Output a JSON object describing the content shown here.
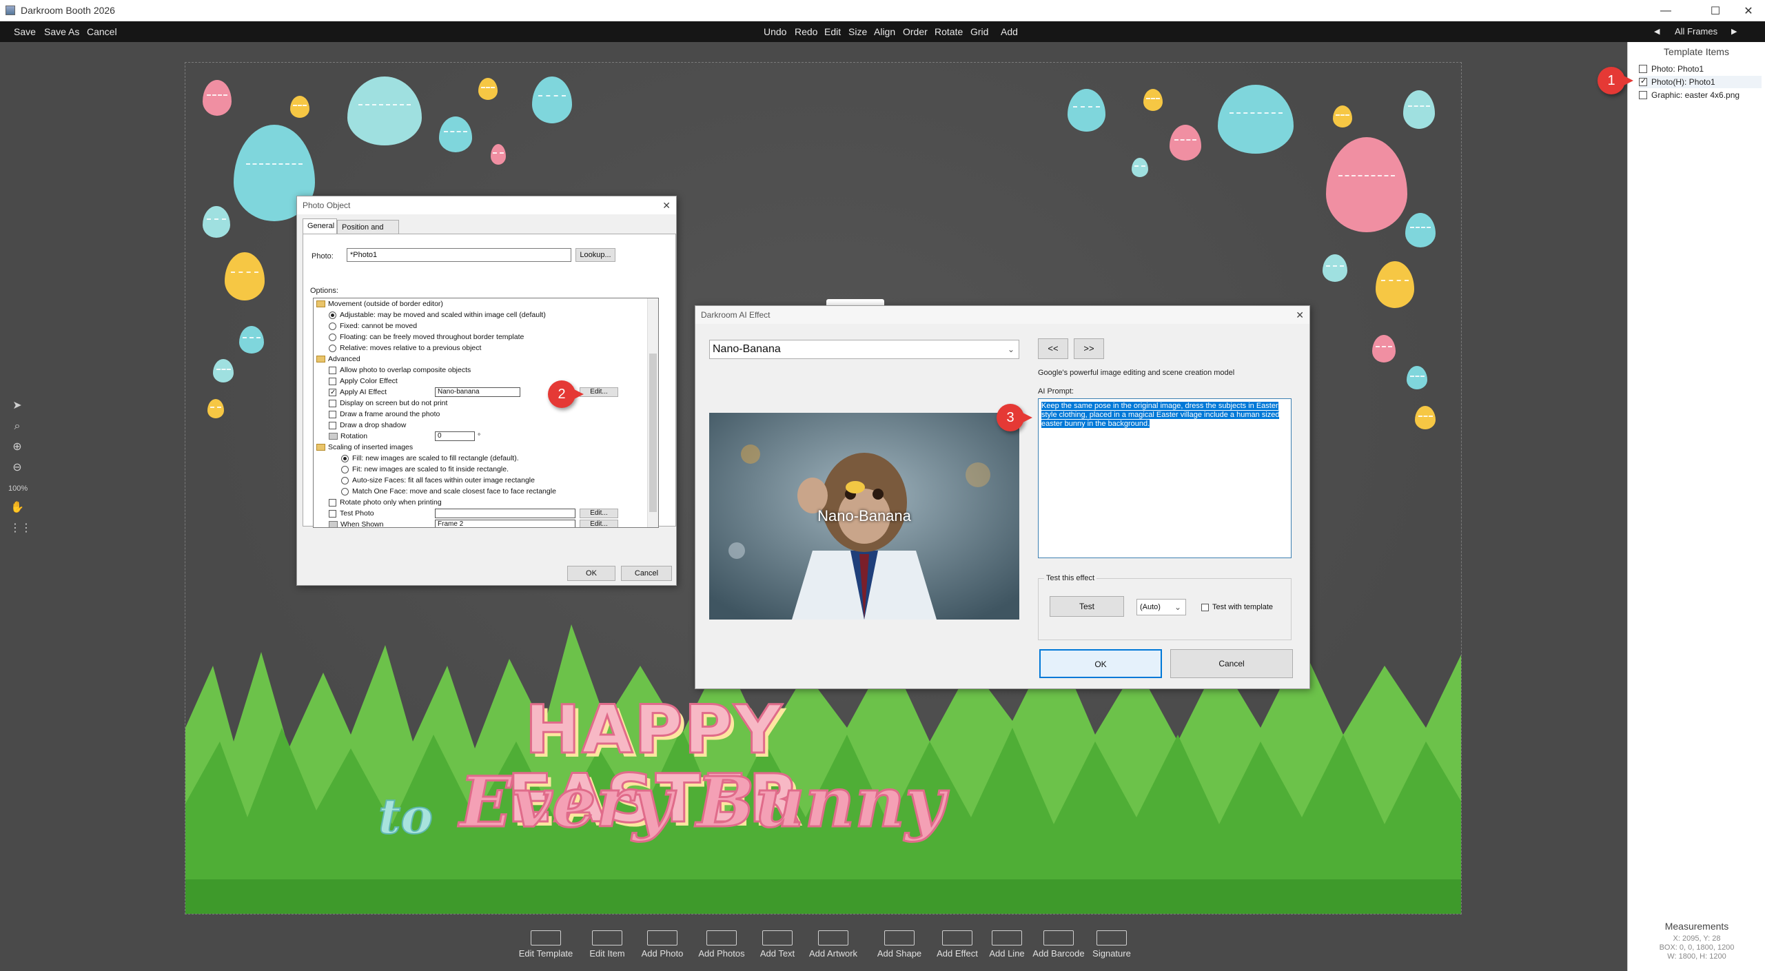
{
  "window": {
    "title": "Darkroom Booth 2026"
  },
  "menubar": {
    "left": [
      "Save",
      "Save As",
      "Cancel"
    ],
    "center": [
      "Undo",
      "Redo",
      "Edit",
      "Size",
      "Align",
      "Order",
      "Rotate",
      "Grid",
      "Add"
    ],
    "frames_label": "All Frames"
  },
  "left_tools": {
    "zoom_label": "100%"
  },
  "template_items": {
    "header": "Template Items",
    "items": [
      {
        "label": "Photo: Photo1",
        "checked": false
      },
      {
        "label": "Photo(H): Photo1",
        "checked": true
      },
      {
        "label": "Graphic: easter 4x6.png",
        "checked": false
      }
    ]
  },
  "measurements": {
    "header": "Measurements",
    "xy": "X: 2095, Y: 28",
    "box": "BOX: 0, 0, 1800, 1200",
    "wh": "W: 1800, H: 1200"
  },
  "canvas": {
    "line1": "HAPPY EASTER",
    "line2_to": "to",
    "line2": "Every Bunny"
  },
  "bottom_toolbar": [
    "Edit Template",
    "Edit Item",
    "Add Photo",
    "Add Photos",
    "Add Text",
    "Add Artwork",
    "Add Shape",
    "Add Effect",
    "Add Line",
    "Add Barcode",
    "Signature"
  ],
  "markers": [
    "1",
    "2",
    "3"
  ],
  "photo_dialog": {
    "title": "Photo Object",
    "tabs": [
      "General",
      "Position and Size"
    ],
    "photo_label": "Photo:",
    "photo_value": "*Photo1",
    "lookup": "Lookup...",
    "options_label": "Options:",
    "options": {
      "movement": "Movement  (outside of border editor)",
      "adjustable": "Adjustable:  may be moved and scaled within image cell (default)",
      "fixed": "Fixed:  cannot be moved",
      "floating": "Floating:  can be freely moved throughout border template",
      "relative": "Relative:  moves relative to a previous object",
      "advanced": "Advanced",
      "overlap": "Allow photo to overlap composite objects",
      "color": "Apply Color Effect",
      "ai": "Apply AI Effect",
      "ai_value": "Nano-banana",
      "display": "Display on screen but do not print",
      "frame": "Draw a frame around the photo",
      "shadow": "Draw a drop shadow",
      "rotation": "Rotation",
      "rotation_value": "0",
      "rotation_unit": "°",
      "scaling": "Scaling of inserted images",
      "fill": "Fill: new images are scaled to fill rectangle (default).",
      "fit": "Fit: new images are scaled to fit inside rectangle.",
      "autosize": "Auto-size Faces: fit all faces within outer image rectangle",
      "matchone": "Match One Face: move and scale closest face to face rectangle",
      "rotate_print": "Rotate photo only when printing",
      "test_photo": "Test Photo",
      "when_shown": "When Shown",
      "when_value": "Frame 2",
      "edit": "Edit..."
    },
    "ok": "OK",
    "cancel": "Cancel"
  },
  "ai_dialog": {
    "title": "Darkroom AI Effect",
    "model": "Nano-Banana",
    "prev": "<<",
    "next": ">>",
    "description": "Google's powerful image editing and scene creation model",
    "preview_label": "Nano-Banana",
    "prompt_label": "AI Prompt:",
    "prompt": "Keep the same pose in the original image, dress the subjects in Easter style clothing, placed in a magical Easter village include a human sized easter bunny in the background.",
    "test_group": "Test this effect",
    "test_btn": "Test",
    "auto": "(Auto)",
    "test_with_template": "Test with template",
    "ok": "OK",
    "cancel": "Cancel"
  }
}
